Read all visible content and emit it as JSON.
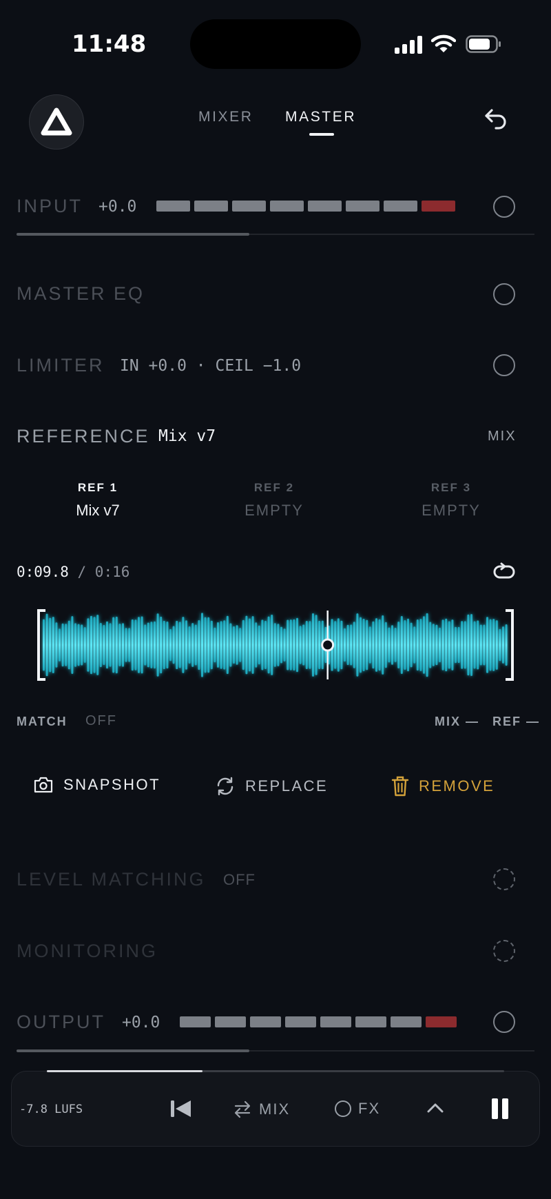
{
  "status": {
    "time": "11:48"
  },
  "nav": {
    "tabs": [
      {
        "label": "MIXER"
      },
      {
        "label": "MASTER"
      }
    ],
    "active_tab": "MASTER"
  },
  "input": {
    "title": "INPUT",
    "value": "+0.0",
    "fader_level": 0.45
  },
  "master_eq": {
    "title": "MASTER EQ"
  },
  "limiter": {
    "title": "LIMITER",
    "value": "IN +0.0 · CEIL −1.0"
  },
  "reference": {
    "title": "REFERENCE",
    "current": "Mix v7",
    "mix_label": "MIX",
    "refs": [
      {
        "label": "REF 1",
        "name": "Mix v7"
      },
      {
        "label": "REF 2",
        "name": "EMPTY"
      },
      {
        "label": "REF 3",
        "name": "EMPTY"
      }
    ],
    "position": "0:09.8",
    "duration": "0:16",
    "playhead_fraction": 0.61,
    "match_label": "MATCH",
    "match_value": "OFF",
    "mix_meter_label": "MIX —",
    "ref_meter_label": "REF —",
    "actions": {
      "snapshot": "SNAPSHOT",
      "replace": "REPLACE",
      "remove": "REMOVE"
    }
  },
  "level_matching": {
    "title": "LEVEL MATCHING",
    "value": "OFF"
  },
  "monitoring": {
    "title": "MONITORING"
  },
  "output": {
    "title": "OUTPUT",
    "value": "+0.0",
    "fader_level": 0.45
  },
  "transport": {
    "lufs": "-7.8 LUFS",
    "mix_label": "MIX",
    "fx_label": "FX",
    "progress": 0.34
  },
  "colors": {
    "accent_wave": "#3fd3e6",
    "remove": "#d4a23a",
    "meter_red": "#8c2b2e"
  }
}
